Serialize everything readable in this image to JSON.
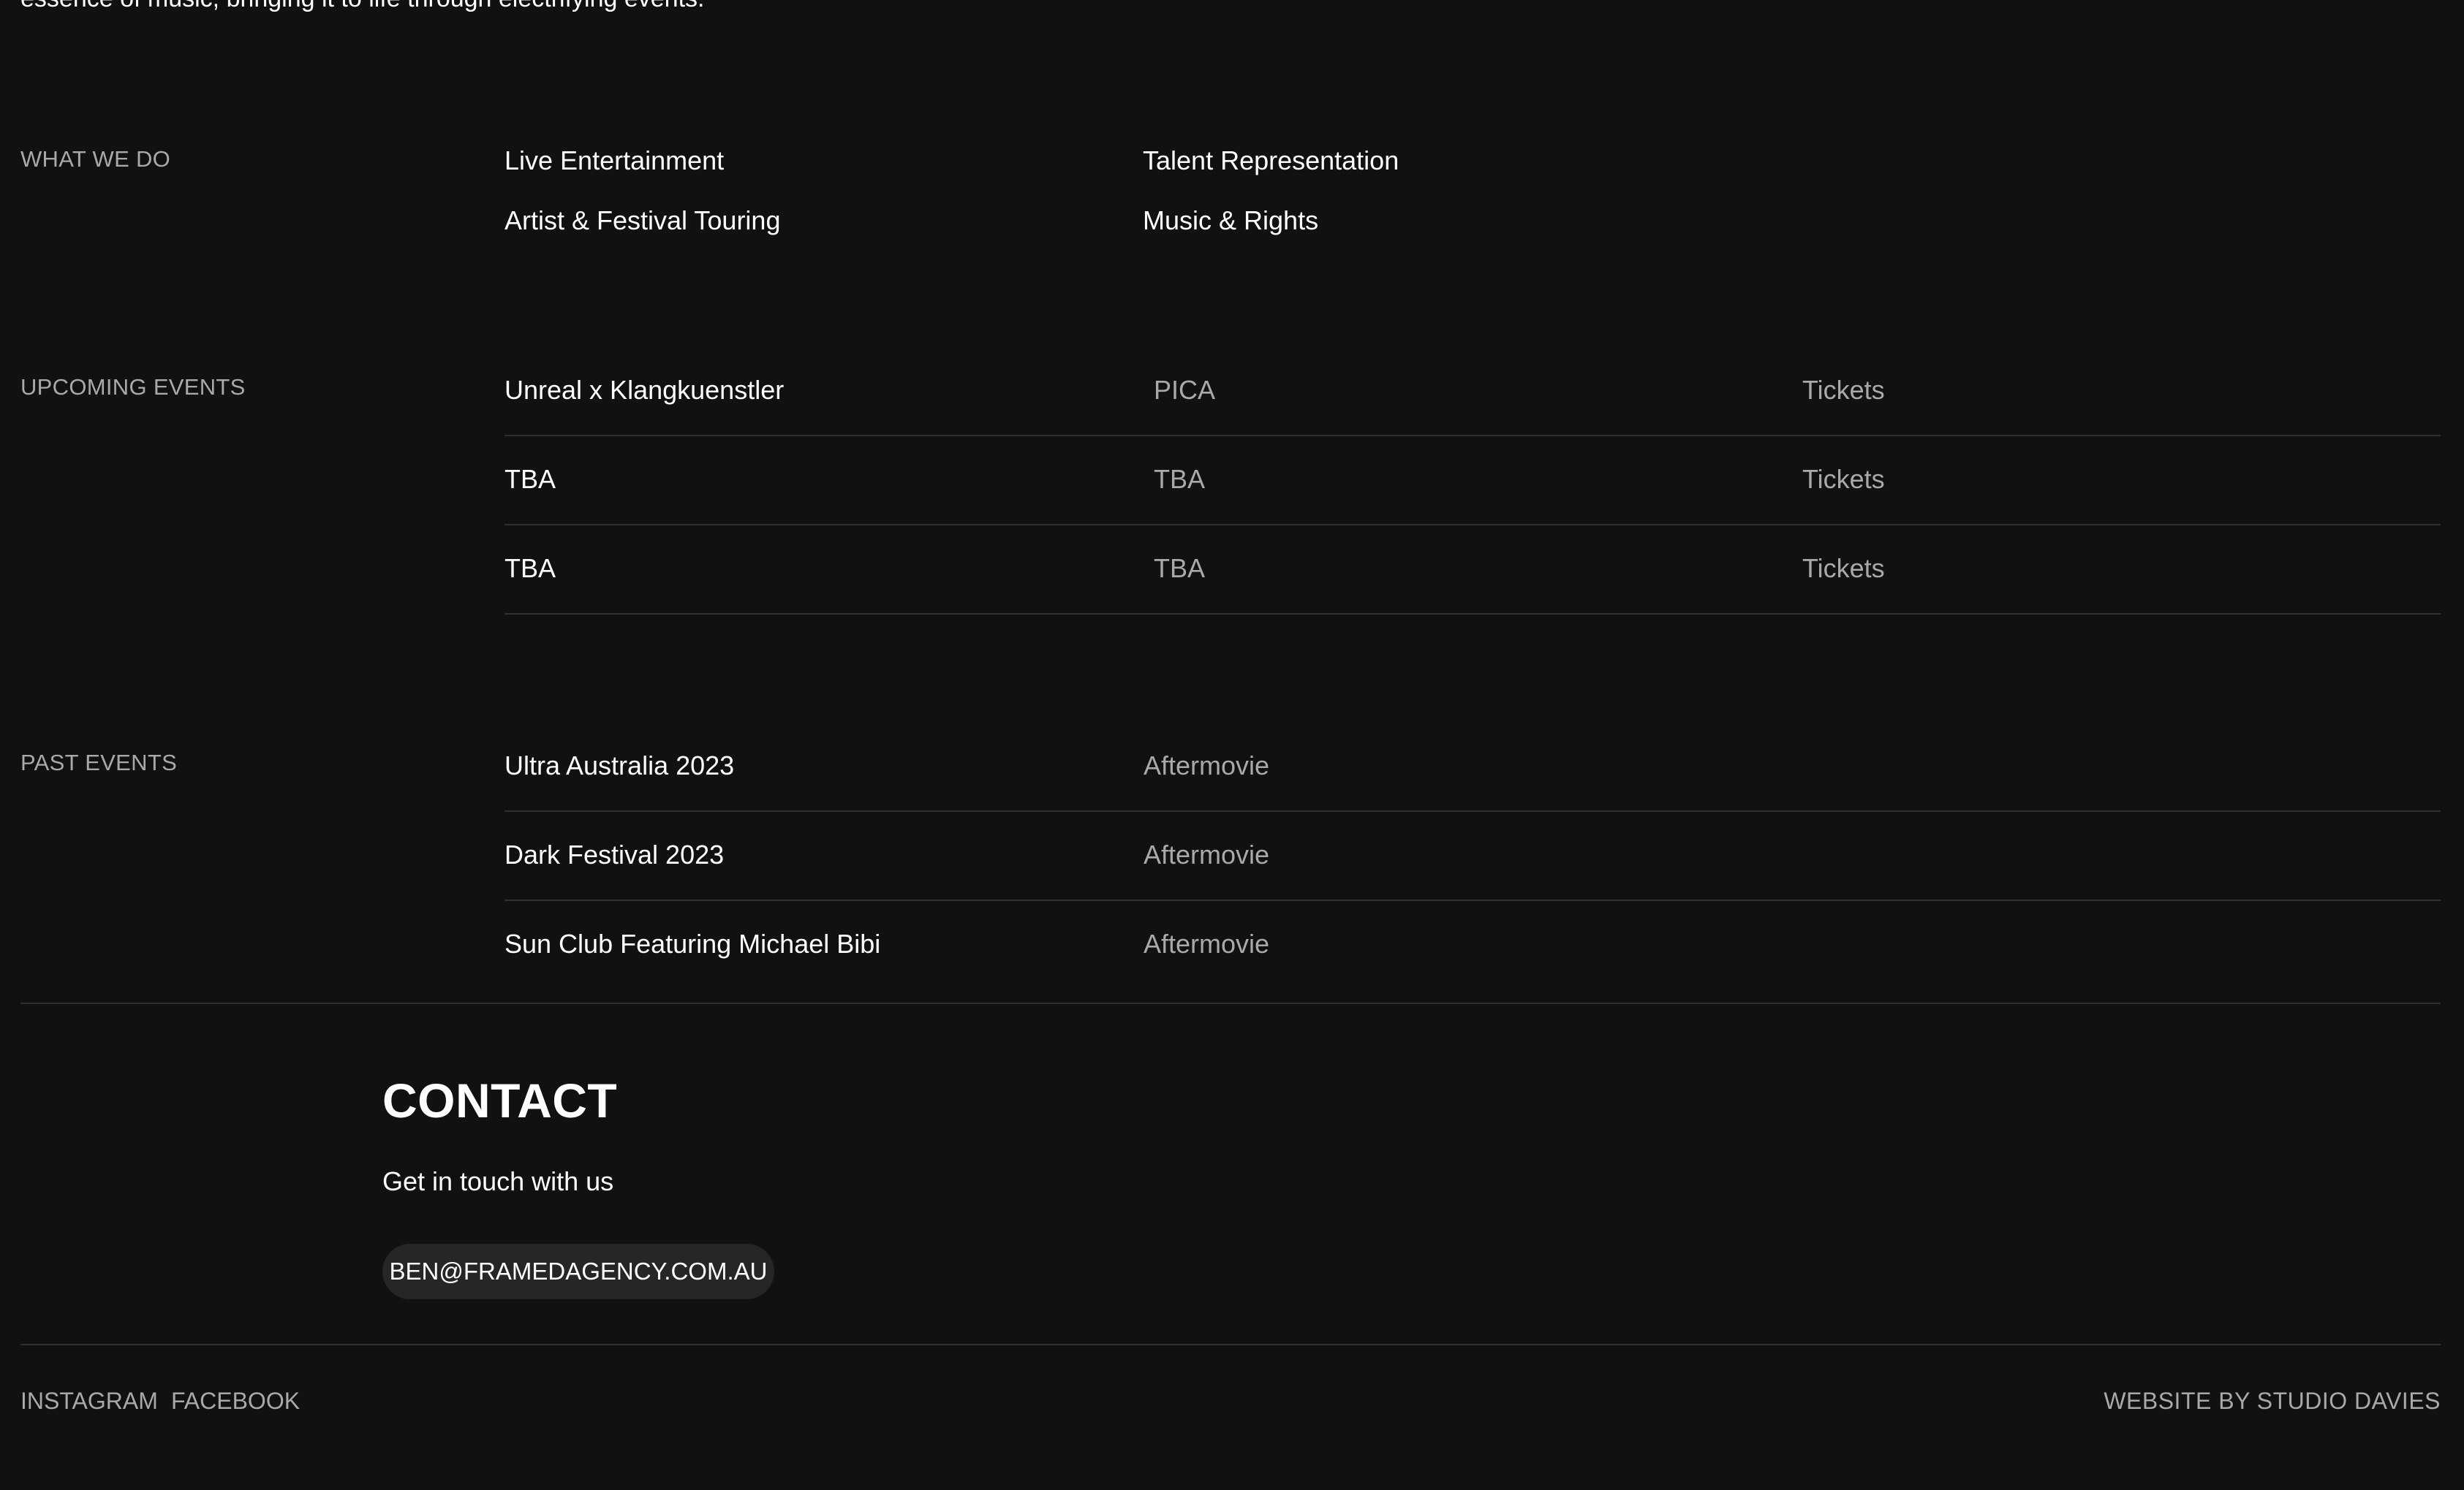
{
  "intro": {
    "text": "essence of music, bringing it to life through electrifying events."
  },
  "what_we_do": {
    "label": "WHAT WE DO",
    "services": [
      "Live Entertainment",
      "Talent Representation",
      "Artist & Festival Touring",
      "Music & Rights"
    ]
  },
  "upcoming_events": {
    "label": "UPCOMING EVENTS",
    "rows": [
      {
        "name": "Unreal x Klangkuenstler",
        "venue": "PICA",
        "link": "Tickets"
      },
      {
        "name": "TBA",
        "venue": "TBA",
        "link": "Tickets"
      },
      {
        "name": "TBA",
        "venue": "TBA",
        "link": "Tickets"
      }
    ]
  },
  "past_events": {
    "label": "PAST EVENTS",
    "rows": [
      {
        "name": "Ultra Australia 2023",
        "link": "Aftermovie"
      },
      {
        "name": "Dark Festival 2023",
        "link": "Aftermovie"
      },
      {
        "name": "Sun Club Featuring Michael Bibi",
        "link": "Aftermovie"
      }
    ]
  },
  "contact": {
    "title": "CONTACT",
    "subtitle": "Get in touch with us",
    "email": "BEN@FRAMEDAGENCY.COM.AU"
  },
  "footer": {
    "links": [
      "INSTAGRAM",
      "FACEBOOK"
    ],
    "credit": "WEBSITE BY STUDIO DAVIES"
  },
  "colors": {
    "background": "#111111",
    "text_primary": "#ffffff",
    "text_secondary": "#a9a9a9",
    "divider": "#2f2f2f",
    "button_bg": "#262626"
  }
}
